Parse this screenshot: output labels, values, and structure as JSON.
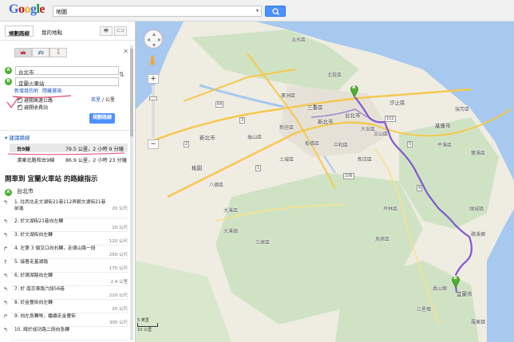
{
  "header": {
    "logo": "Google",
    "search_value": "地圖",
    "search_dropdown_icon": "chevron-down-icon",
    "search_button_icon": "search-icon",
    "colors": {
      "accent": "#4d90fe",
      "logo": [
        "#3369e8",
        "#d50f25",
        "#eeb211",
        "#3369e8",
        "#009925",
        "#d50f25"
      ]
    }
  },
  "panel": {
    "tabs": [
      {
        "label": "規劃路線"
      },
      {
        "label": "我的地點"
      }
    ],
    "tool_icons": [
      "print-icon",
      "link-icon"
    ],
    "modes": [
      "car-icon",
      "transit-icon",
      "walk-icon"
    ],
    "waypoints": [
      {
        "marker": "A",
        "value": "台北市"
      },
      {
        "marker": "B",
        "value": "宜蘭火車站"
      }
    ],
    "links": {
      "add_destination": "新增目的地",
      "hide_options": "隱藏選項"
    },
    "options": [
      {
        "label": "避開高速公路",
        "checked": true
      },
      {
        "label": "避開收費站",
        "checked": true
      }
    ],
    "units": {
      "km": "英里",
      "sep": "/",
      "mi": "公里"
    },
    "get_directions_label": "規劃路線",
    "suggested_routes_label": "建議路線",
    "routes": [
      {
        "via": "台9線",
        "stats": "79.5 公里，2 小時 9 分鐘",
        "selected": true
      },
      {
        "via": "濱東北路和台9線",
        "stats": "86.9 公里，2 小時 23 分鐘",
        "selected": false
      }
    ],
    "steps_title": "開車到 宜蘭火車站 的路線指示",
    "start": {
      "marker": "A",
      "label": "台北市"
    },
    "steps": [
      {
        "icon": "turn-left-icon",
        "text": "1. 往西北走文湖街21巷112弄朝文湖街21巷前進",
        "dist": "20 公尺"
      },
      {
        "icon": "turn-left-icon",
        "text": "2. 於文湖街21巷向左轉",
        "dist": "10 公尺"
      },
      {
        "icon": "turn-left-icon",
        "text": "3. 於文湖街向左轉",
        "dist": "120 公尺"
      },
      {
        "icon": "turn-right-icon",
        "text": "4. 左第 3 個叉口向右轉，走環山路一段",
        "dist": "250 公尺"
      },
      {
        "icon": "straight-icon",
        "text": "5. 接著走基湖路",
        "dist": "170 公尺"
      },
      {
        "icon": "turn-left-icon",
        "text": "6. 於環湖路向左轉",
        "dist": "2.4 公里"
      },
      {
        "icon": "turn-left-icon",
        "text": "7. 於 南京東路六段56巷",
        "dist": "210 公尺"
      },
      {
        "icon": "turn-left-icon",
        "text": "8. 於金豐街向左轉",
        "dist": "20 公尺"
      },
      {
        "icon": "turn-right-icon",
        "text": "9. 向左急轉彎，繼續走金豐街",
        "dist": "300 公尺"
      },
      {
        "icon": "turn-left-icon",
        "text": "10. 請於成功路二段向急轉",
        "dist": ""
      }
    ]
  },
  "map": {
    "places": [
      {
        "label": "淡水區",
        "cls": "district"
      },
      {
        "label": "北投區",
        "cls": "district"
      },
      {
        "label": "汐止區",
        "cls": ""
      },
      {
        "label": "三重區",
        "cls": ""
      },
      {
        "label": "新北市",
        "cls": ""
      },
      {
        "label": "台北市",
        "cls": ""
      },
      {
        "label": "新莊區",
        "cls": "district"
      },
      {
        "label": "板橋區",
        "cls": "district"
      },
      {
        "label": "中和區",
        "cls": "district"
      },
      {
        "label": "新店區",
        "cls": "district"
      },
      {
        "label": "大安區",
        "cls": "district"
      },
      {
        "label": "文山區",
        "cls": "district"
      },
      {
        "label": "桃園",
        "cls": ""
      },
      {
        "label": "三峽區",
        "cls": "district"
      },
      {
        "label": "土城區",
        "cls": "district"
      },
      {
        "label": "瑞芳區",
        "cls": "district"
      },
      {
        "label": "基隆市",
        "cls": ""
      },
      {
        "label": "平溪區",
        "cls": "district"
      },
      {
        "label": "雙溪區",
        "cls": "district"
      },
      {
        "label": "坪林區",
        "cls": "district"
      },
      {
        "label": "烏來區",
        "cls": "district"
      },
      {
        "label": "頭城鎮",
        "cls": "district"
      },
      {
        "label": "礁溪鄉",
        "cls": "district"
      },
      {
        "label": "宜蘭市",
        "cls": ""
      },
      {
        "label": "員山鄉",
        "cls": "district"
      },
      {
        "label": "大溪區",
        "cls": "district"
      },
      {
        "label": "八德區",
        "cls": "district"
      },
      {
        "label": "龜山區",
        "cls": "district"
      },
      {
        "label": "蘆洲區",
        "cls": "district"
      },
      {
        "label": "新北市",
        "cls": ""
      },
      {
        "label": "大溪鎮",
        "cls": "district"
      },
      {
        "label": "羅東鎮",
        "cls": "district"
      },
      {
        "label": "三星鄉",
        "cls": "district"
      }
    ],
    "markers": [
      {
        "label": "A"
      },
      {
        "label": "B"
      }
    ],
    "road_shields": [
      "2",
      "5",
      "9",
      "3",
      "1",
      "64",
      "106",
      "102"
    ],
    "scale_label": "5 英里",
    "scale_label2": "10 公里",
    "zoom_in": "+",
    "zoom_out": "−",
    "colors": {
      "land": "#efece2",
      "mountain": "#cfe3c4",
      "water": "#a7c8ef",
      "route": "#7a4fd3",
      "highway": "#f5c84c"
    }
  }
}
